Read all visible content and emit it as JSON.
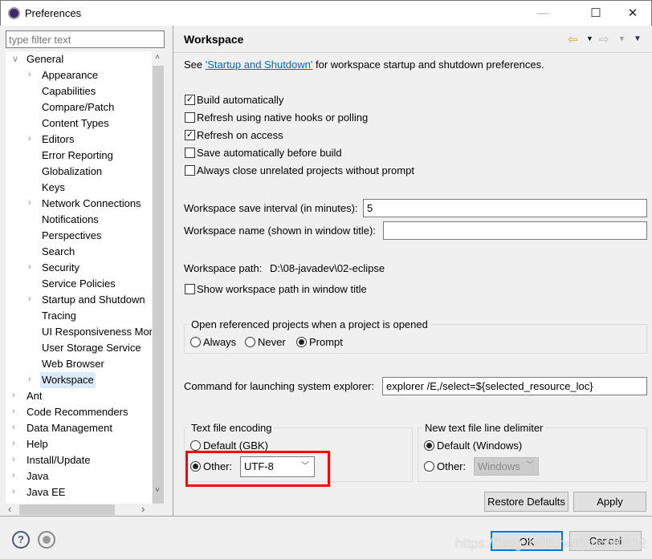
{
  "window": {
    "title": "Preferences",
    "minimize": "—",
    "maximize": "☐",
    "close": "✕"
  },
  "sidebar": {
    "filter_placeholder": "type filter text",
    "items": [
      {
        "label": "General",
        "level": 0,
        "expanded": true
      },
      {
        "label": "Appearance",
        "level": 1,
        "expandable": true
      },
      {
        "label": "Capabilities",
        "level": 1
      },
      {
        "label": "Compare/Patch",
        "level": 1
      },
      {
        "label": "Content Types",
        "level": 1
      },
      {
        "label": "Editors",
        "level": 1,
        "expandable": true
      },
      {
        "label": "Error Reporting",
        "level": 1
      },
      {
        "label": "Globalization",
        "level": 1
      },
      {
        "label": "Keys",
        "level": 1
      },
      {
        "label": "Network Connections",
        "level": 1,
        "expandable": true
      },
      {
        "label": "Notifications",
        "level": 1
      },
      {
        "label": "Perspectives",
        "level": 1
      },
      {
        "label": "Search",
        "level": 1
      },
      {
        "label": "Security",
        "level": 1,
        "expandable": true
      },
      {
        "label": "Service Policies",
        "level": 1
      },
      {
        "label": "Startup and Shutdown",
        "level": 1,
        "expandable": true
      },
      {
        "label": "Tracing",
        "level": 1
      },
      {
        "label": "UI Responsiveness Mor",
        "level": 1
      },
      {
        "label": "User Storage Service",
        "level": 1
      },
      {
        "label": "Web Browser",
        "level": 1
      },
      {
        "label": "Workspace",
        "level": 1,
        "expandable": true,
        "selected": true
      },
      {
        "label": "Ant",
        "level": 0
      },
      {
        "label": "Code Recommenders",
        "level": 0
      },
      {
        "label": "Data Management",
        "level": 0
      },
      {
        "label": "Help",
        "level": 0
      },
      {
        "label": "Install/Update",
        "level": 0
      },
      {
        "label": "Java",
        "level": 0
      },
      {
        "label": "Java EE",
        "level": 0
      }
    ]
  },
  "main": {
    "title": "Workspace",
    "intro_pre": "See ",
    "intro_link": "'Startup and Shutdown'",
    "intro_post": " for workspace startup and shutdown preferences.",
    "checkboxes": [
      {
        "label": "Build automatically",
        "checked": true
      },
      {
        "label": "Refresh using native hooks or polling",
        "checked": false
      },
      {
        "label": "Refresh on access",
        "checked": true
      },
      {
        "label": "Save automatically before build",
        "checked": false
      },
      {
        "label": "Always close unrelated projects without prompt",
        "checked": false
      }
    ],
    "save_interval_label": "Workspace save interval (in minutes):",
    "save_interval_value": "5",
    "ws_name_label": "Workspace name (shown in window title):",
    "ws_name_value": "",
    "ws_path_label": "Workspace path:",
    "ws_path_value": "D:\\08-javadev\\02-eclipse",
    "show_path_label": "Show workspace path in window title",
    "show_path_checked": false,
    "open_ref": {
      "title": "Open referenced projects when a project is opened",
      "options": [
        "Always",
        "Never",
        "Prompt"
      ],
      "selected": "Prompt"
    },
    "explorer_label": "Command for launching system explorer:",
    "explorer_value": "explorer /E,/select=${selected_resource_loc}",
    "encoding": {
      "title": "Text file encoding",
      "default_label": "Default (GBK)",
      "other_label": "Other:",
      "selected": "Other",
      "value": "UTF-8"
    },
    "delimiter": {
      "title": "New text file line delimiter",
      "default_label": "Default (Windows)",
      "other_label": "Other:",
      "selected": "Default",
      "value": "Windows"
    },
    "restore_defaults": "Restore Defaults",
    "apply": "Apply"
  },
  "footer": {
    "ok": "OK",
    "cancel": "Cancel"
  },
  "watermark": "https://blog.csdn.net/yinchl0612",
  "colors": {
    "highlight_box": "#ff0000",
    "link": "#0066cc",
    "selection": "#dcebf9",
    "ok_border": "#0078d7"
  }
}
